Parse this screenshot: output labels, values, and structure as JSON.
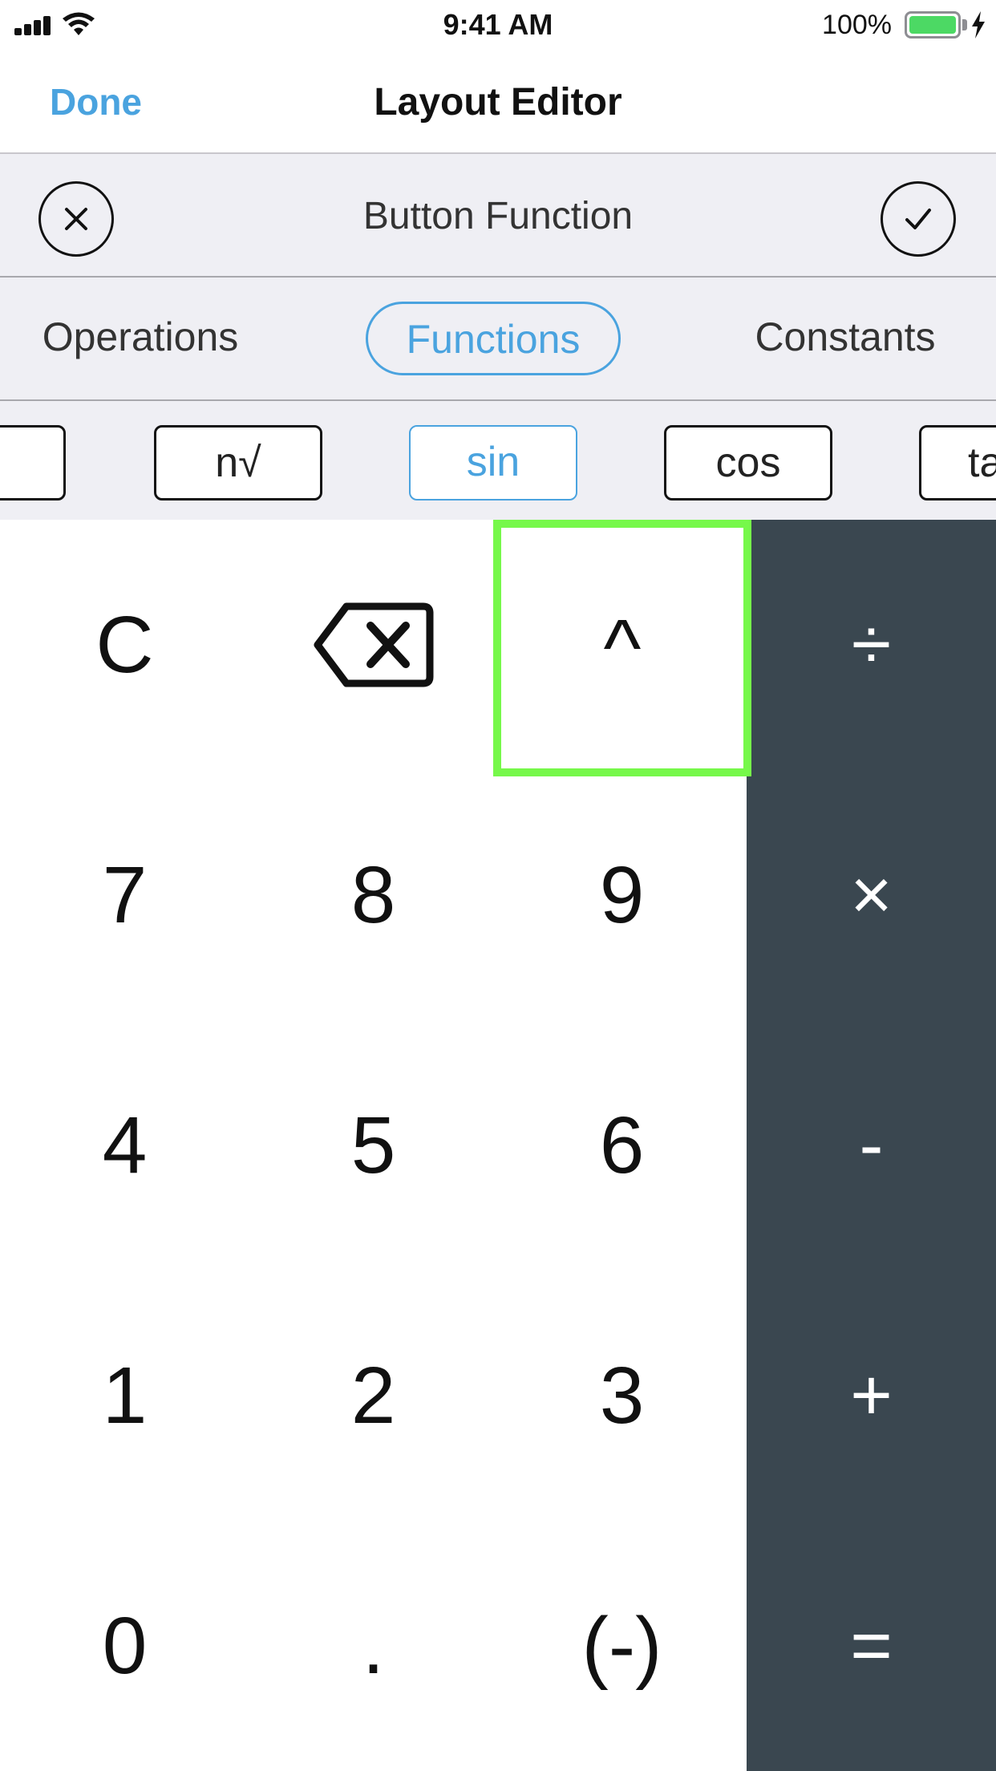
{
  "status_bar": {
    "time": "9:41 AM",
    "battery_percent": "100%",
    "battery_level": 1.0,
    "battery_color": "#4cd964",
    "icons": [
      "signal-icon",
      "wifi-icon",
      "battery-icon",
      "charging-bolt-icon"
    ]
  },
  "nav": {
    "done_label": "Done",
    "title": "Layout Editor",
    "accent_color": "#4aa3df"
  },
  "editor": {
    "title": "Button Function",
    "cancel_icon": "close-icon",
    "confirm_icon": "checkmark-icon"
  },
  "categories": [
    {
      "label": "Operations",
      "selected": false
    },
    {
      "label": "Functions",
      "selected": true
    },
    {
      "label": "Constants",
      "selected": false
    }
  ],
  "functions": [
    {
      "label": "",
      "selected": false
    },
    {
      "label": "n√",
      "selected": false
    },
    {
      "label": "sin",
      "selected": true
    },
    {
      "label": "cos",
      "selected": false
    },
    {
      "label": "ta",
      "selected": false
    }
  ],
  "keypad": {
    "selection_color": "#76f84a",
    "operator_background": "#3a4750",
    "rows": [
      [
        "C",
        "backspace",
        "^",
        "÷"
      ],
      [
        "7",
        "8",
        "9",
        "×"
      ],
      [
        "4",
        "5",
        "6",
        "-"
      ],
      [
        "1",
        "2",
        "3",
        "+"
      ],
      [
        "0",
        ".",
        "(-)",
        "="
      ]
    ],
    "selected_key": "^"
  }
}
